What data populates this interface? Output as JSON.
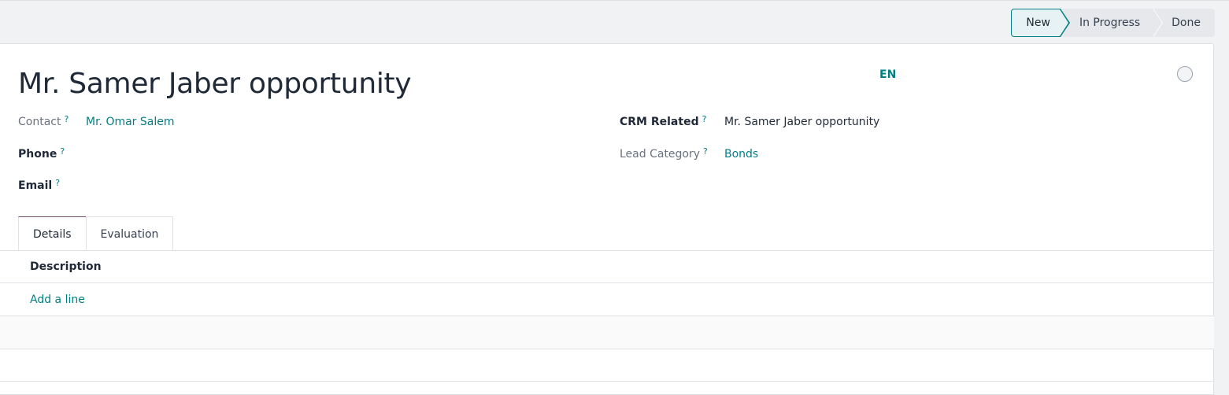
{
  "status_bar": {
    "stages": [
      "New",
      "In Progress",
      "Done"
    ],
    "active": "New"
  },
  "record": {
    "title": "Mr. Samer Jaber opportunity",
    "language": "EN"
  },
  "fields": {
    "contact": {
      "label": "Contact",
      "help": "?",
      "value": "Mr. Omar Salem"
    },
    "phone": {
      "label": "Phone",
      "help": "?",
      "value": ""
    },
    "email": {
      "label": "Email",
      "help": "?",
      "value": ""
    },
    "crm_related": {
      "label": "CRM Related",
      "help": "?",
      "value": "Mr. Samer Jaber opportunity"
    },
    "lead_category": {
      "label": "Lead Category",
      "help": "?",
      "value": "Bonds"
    }
  },
  "tabs": [
    {
      "label": "Details",
      "active": true
    },
    {
      "label": "Evaluation",
      "active": false
    }
  ],
  "details_table": {
    "column_header": "Description",
    "add_line_label": "Add a line"
  },
  "colors": {
    "accent": "#017e84",
    "active_tab_border": "#714b67",
    "background": "#f1f2f4"
  }
}
